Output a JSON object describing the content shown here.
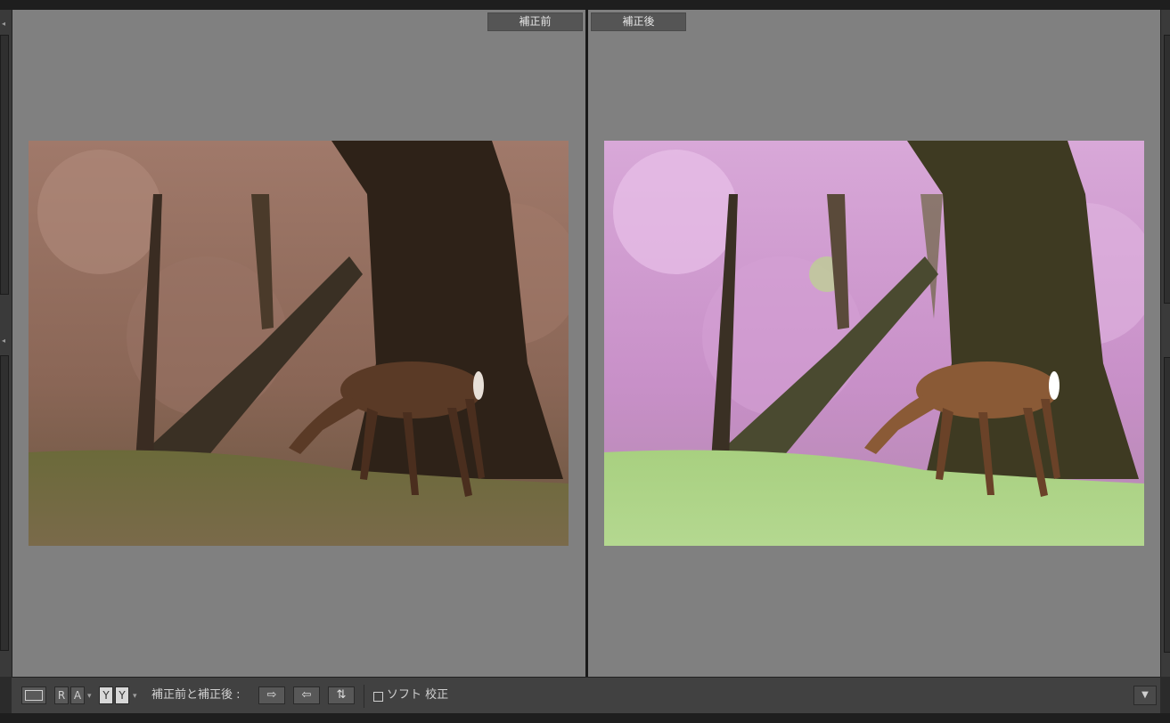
{
  "panes": {
    "before_label": "補正前",
    "after_label": "補正後"
  },
  "toolbar": {
    "view_mode_icon": "loupe-view-icon",
    "ra_segment": [
      "R",
      "A"
    ],
    "yy_segment": [
      "Y",
      "Y"
    ],
    "before_after_label": "補正前と補正後 :",
    "copy_before_to_after": "⇨",
    "copy_after_to_before": "⇦",
    "swap": "⇅",
    "soft_proof_label": "ソフト 校正",
    "soft_proof_checked": false,
    "menu_caret": "▼"
  },
  "colors": {
    "pane_bg": "#808080",
    "toolbar_bg": "#414141",
    "label_bg": "#555555"
  }
}
